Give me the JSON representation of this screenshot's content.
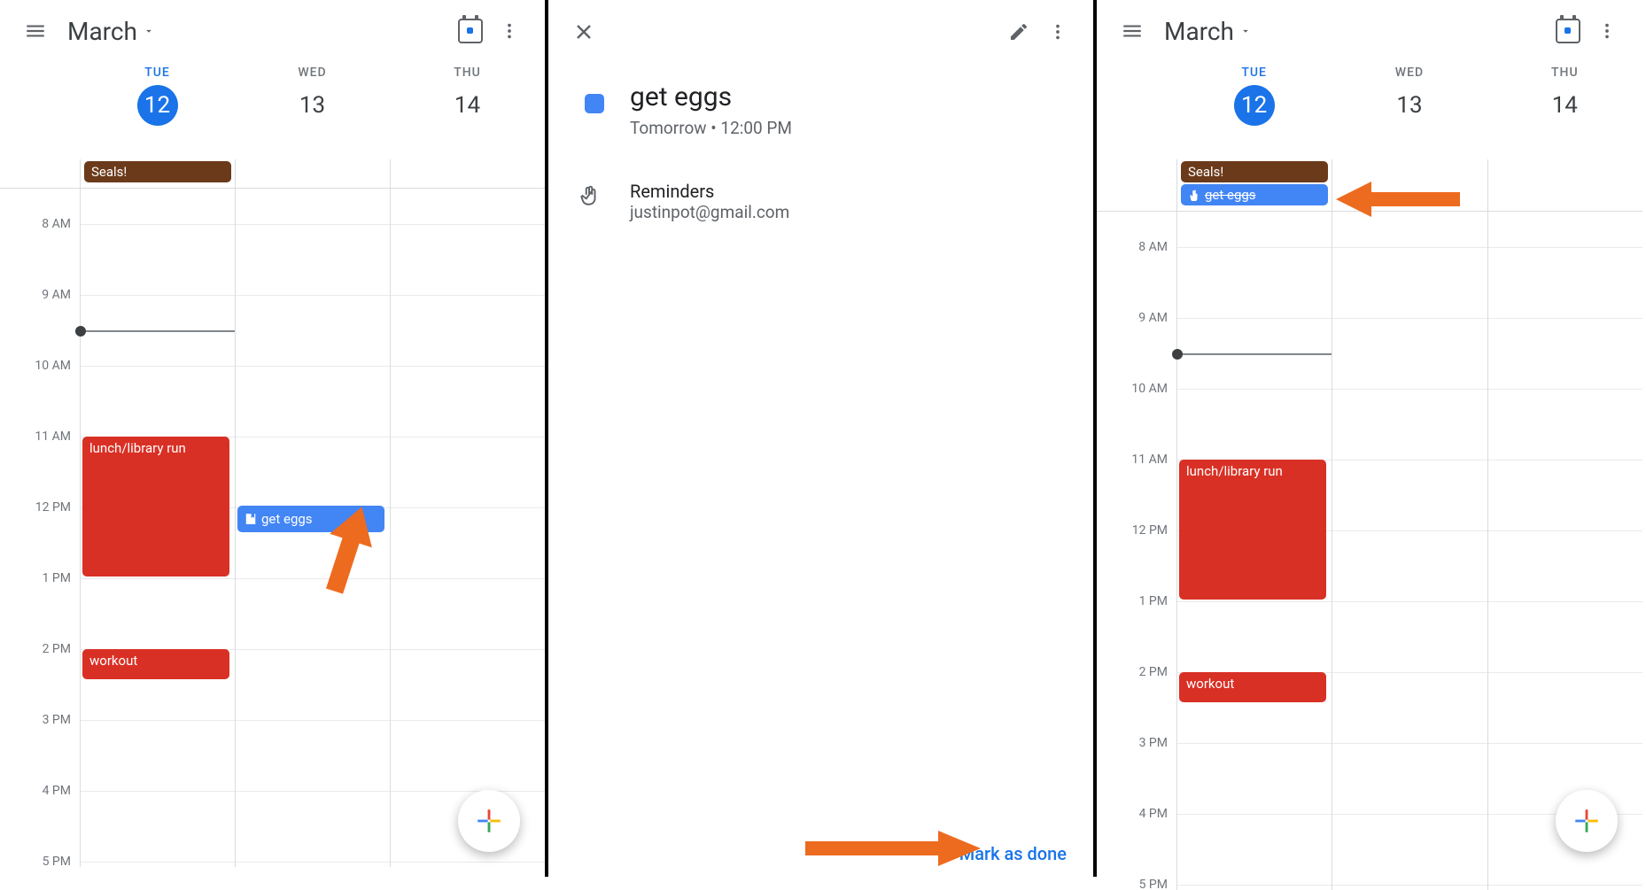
{
  "calendar": {
    "month_label": "March",
    "days": [
      {
        "abbr": "TUE",
        "num": "12",
        "today": true
      },
      {
        "abbr": "WED",
        "num": "13",
        "today": false
      },
      {
        "abbr": "THU",
        "num": "14",
        "today": false
      }
    ],
    "hours": [
      "8 AM",
      "9 AM",
      "10 AM",
      "11 AM",
      "12 PM",
      "1 PM",
      "2 PM",
      "3 PM",
      "4 PM",
      "5 PM"
    ],
    "allday_left": {
      "seals": "Seals!"
    },
    "allday_right": {
      "seals": "Seals!",
      "geteggs": "get eggs"
    },
    "events": {
      "lunch": "lunch/library run",
      "workout": "workout",
      "geteggs": "get eggs"
    }
  },
  "detail": {
    "title": "get eggs",
    "when": "Tomorrow  •  12:00 PM",
    "section_label": "Reminders",
    "account": "justinpot@gmail.com",
    "mark_done": "Mark as done"
  }
}
